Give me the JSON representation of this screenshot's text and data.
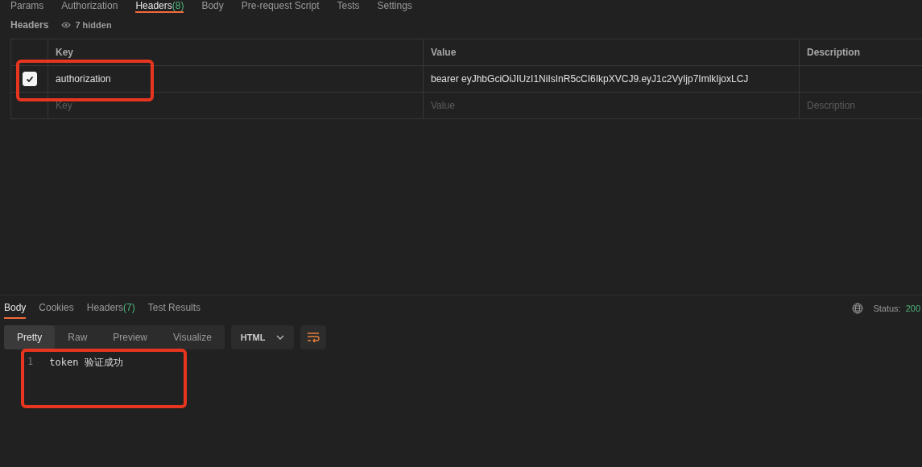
{
  "request_tabs": [
    {
      "label": "Params",
      "selected": false
    },
    {
      "label": "Authorization",
      "selected": false
    },
    {
      "label": "Headers",
      "count": "(8)",
      "selected": true
    },
    {
      "label": "Body",
      "selected": false
    },
    {
      "label": "Pre-request Script",
      "selected": false
    },
    {
      "label": "Tests",
      "selected": false
    },
    {
      "label": "Settings",
      "selected": false
    }
  ],
  "headers_section": {
    "title": "Headers",
    "hidden_toggle": "7 hidden"
  },
  "headers_table": {
    "columns": [
      "Key",
      "Value",
      "Description"
    ],
    "rows": [
      {
        "checked": true,
        "key": "authorization",
        "value": "bearer eyJhbGciOiJIUzI1NiIsInR5cCI6IkpXVCJ9.eyJ1c2VyIjp7ImlkIjoxLCJ",
        "description": ""
      }
    ],
    "new_row": [
      {
        "placeholder": "Key"
      },
      {
        "placeholder": "Value"
      },
      {
        "placeholder": "Description"
      }
    ]
  },
  "response": {
    "tabs": [
      {
        "label": "Body",
        "selected": true
      },
      {
        "label": "Cookies",
        "selected": false
      },
      {
        "label": "Headers",
        "count": "(7)",
        "selected": false
      },
      {
        "label": "Test Results",
        "selected": false
      }
    ],
    "status_label": "Status:",
    "status_value": "200",
    "view_modes": [
      {
        "label": "Pretty",
        "selected": true
      },
      {
        "label": "Raw",
        "selected": false
      },
      {
        "label": "Preview",
        "selected": false
      },
      {
        "label": "Visualize",
        "selected": false
      }
    ],
    "format": "HTML",
    "lines": [
      {
        "number": "1",
        "text": "token 验证成功"
      }
    ]
  }
}
